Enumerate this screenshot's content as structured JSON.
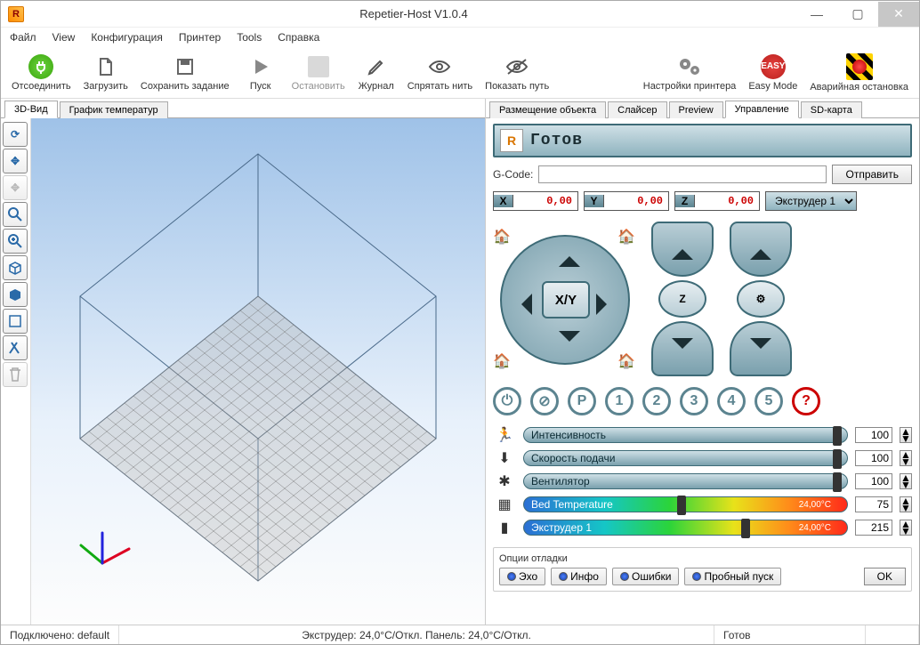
{
  "window": {
    "title": "Repetier-Host V1.0.4"
  },
  "menu": [
    "Файл",
    "View",
    "Конфигурация",
    "Принтер",
    "Tools",
    "Справка"
  ],
  "toolbar": {
    "connect": "Отсоединить",
    "load": "Загрузить",
    "save": "Сохранить задание",
    "run": "Пуск",
    "stop": "Остановить",
    "log": "Журнал",
    "hide": "Спрятать нить",
    "show": "Показать путь",
    "settings": "Настройки принтера",
    "easy": "Easy Mode",
    "easy_badge": "EASY",
    "emerg": "Аварийная остановка"
  },
  "left_tabs": {
    "view3d": "3D-Вид",
    "tempgraph": "График температур"
  },
  "right_tabs": {
    "place": "Размещение объекта",
    "slicer": "Слайсер",
    "preview": "Preview",
    "control": "Управление",
    "sd": "SD-карта"
  },
  "status": {
    "text": "Готов"
  },
  "gcode": {
    "label": "G-Code:",
    "value": "",
    "send": "Отправить"
  },
  "coords": {
    "x_label": "X",
    "x": "0,00",
    "y_label": "Y",
    "y": "0,00",
    "z_label": "Z",
    "z": "0,00",
    "extruder": "Экструдер 1"
  },
  "jog": {
    "xy": "X/Y",
    "z": "Z"
  },
  "quick": {
    "p": "P",
    "n1": "1",
    "n2": "2",
    "n3": "3",
    "n4": "4",
    "n5": "5",
    "help": "?"
  },
  "sliders": {
    "speed": {
      "label": "Интенсивность",
      "value": "100"
    },
    "feed": {
      "label": "Скорость подачи",
      "value": "100"
    },
    "fan": {
      "label": "Вентилятор",
      "value": "100"
    },
    "bed": {
      "label": "Bed Temperature",
      "reading": "24,00°C",
      "value": "75"
    },
    "ext": {
      "label": "Экструдер 1",
      "reading": "24,00°C",
      "value": "215"
    }
  },
  "debug": {
    "title": "Опции отладки",
    "echo": "Эхо",
    "info": "Инфо",
    "errors": "Ошибки",
    "dry": "Пробный пуск",
    "ok": "OK"
  },
  "statusbar": {
    "conn": "Подключено: default",
    "temps": "Экструдер: 24,0°C/Откл. Панель: 24,0°C/Откл.",
    "ready": "Готов"
  }
}
